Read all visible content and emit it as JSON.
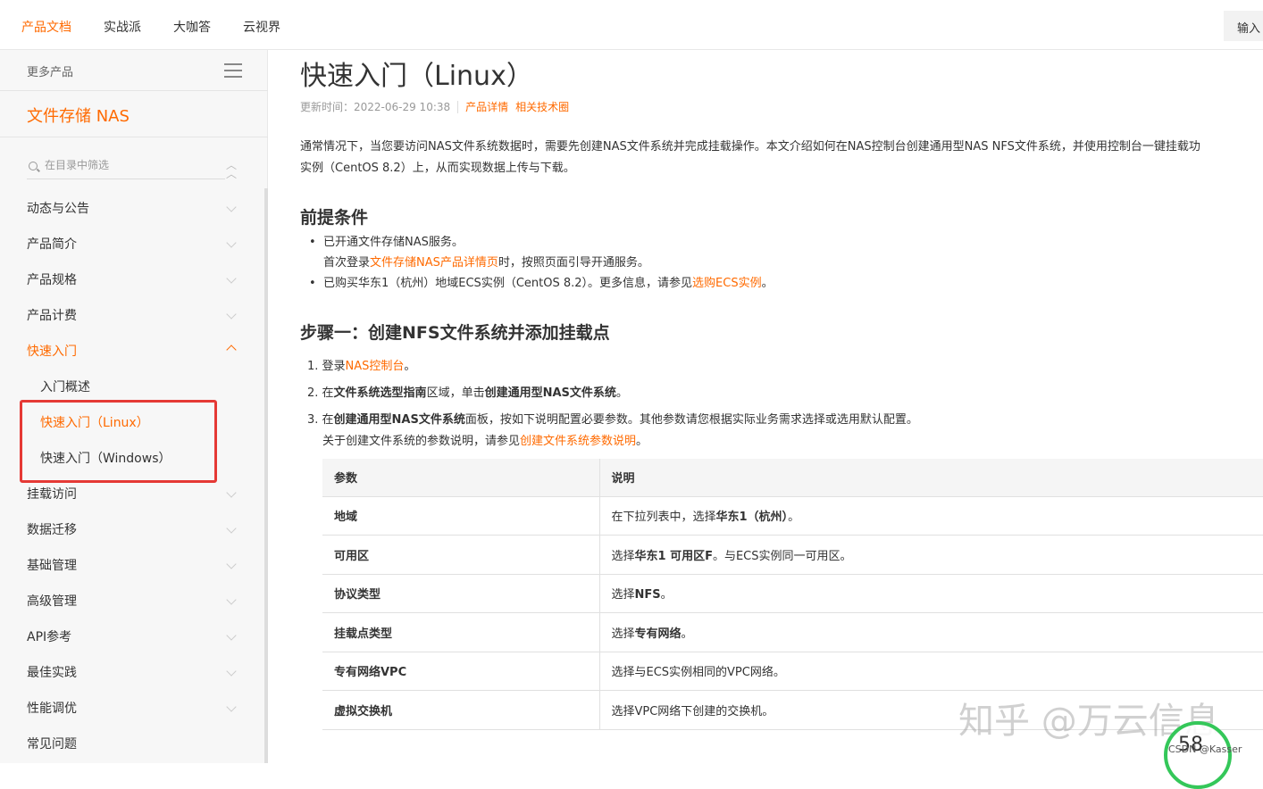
{
  "topnav": {
    "tabs": [
      "产品文档",
      "实战派",
      "大咖答",
      "云视界"
    ],
    "input_btn": "输入"
  },
  "sidebar": {
    "more_products": "更多产品",
    "product_title": "文件存储 NAS",
    "filter_placeholder": "在目录中筛选",
    "items": [
      "动态与公告",
      "产品简介",
      "产品规格",
      "产品计费",
      "快速入门",
      "挂载访问",
      "数据迁移",
      "基础管理",
      "高级管理",
      "API参考",
      "最佳实践",
      "性能调优",
      "常见问题"
    ],
    "sub_items": [
      "入门概述",
      "快速入门（Linux）",
      "快速入门（Windows）"
    ]
  },
  "main": {
    "title": "快速入门（Linux）",
    "meta": {
      "updated": "更新时间：2022-06-29 10:38",
      "link1": "产品详情",
      "link2": "相关技术圈"
    },
    "intro_line1": "通常情况下，当您要访问NAS文件系统数据时，需要先创建NAS文件系统并完成挂载操作。本文介绍如何在NAS控制台创建通用型NAS NFS文件系统，并使用控制台一键挂载功",
    "intro_line2": "实例（CentOS 8.2）上，从而实现数据上传与下载。",
    "prereq_heading": "前提条件",
    "prereq": {
      "b1": "已开通文件存储NAS服务。",
      "b1_sub_a": "首次登录",
      "b1_sub_link": "文件存储NAS产品详情页",
      "b1_sub_b": "时，按照页面引导开通服务。",
      "b2_a": "已购买华东1（杭州）地域ECS实例（CentOS 8.2）。更多信息，请参见",
      "b2_link": "选购ECS实例",
      "b2_b": "。"
    },
    "step1_heading": "步骤一：创建NFS文件系统并添加挂载点",
    "steps": {
      "s1_a": "1. 登录",
      "s1_link": "NAS控制台",
      "s1_b": "。",
      "s2_a": "2. 在",
      "s2_bold1": "文件系统选型指南",
      "s2_b": "区域，单击",
      "s2_bold2": "创建通用型NAS文件系统",
      "s2_c": "。",
      "s3_a": "3. 在",
      "s3_bold": "创建通用型NAS文件系统",
      "s3_b": "面板，按如下说明配置必要参数。其他参数请您根据实际业务需求选择或选用默认配置。",
      "s3_sub_a": "关于创建文件系统的参数说明，请参见",
      "s3_sub_link": "创建文件系统参数说明",
      "s3_sub_b": "。"
    },
    "table": {
      "headers": [
        "参数",
        "说明"
      ],
      "rows": [
        {
          "param": "地域",
          "desc_a": "在下拉列表中，选择",
          "desc_bold": "华东1（杭州）",
          "desc_b": "。"
        },
        {
          "param": "可用区",
          "desc_a": "选择",
          "desc_bold": "华东1 可用区F",
          "desc_b": "。与ECS实例同一可用区。"
        },
        {
          "param": "协议类型",
          "desc_a": "选择",
          "desc_bold": "NFS",
          "desc_b": "。"
        },
        {
          "param": "挂载点类型",
          "desc_a": "选择",
          "desc_bold": "专有网络",
          "desc_b": "。"
        },
        {
          "param": "专有网络VPC",
          "desc_a": "选择与ECS实例相同的VPC网络。",
          "desc_bold": "",
          "desc_b": ""
        },
        {
          "param": "虚拟交换机",
          "desc_a": "选择VPC网络下创建的交换机。",
          "desc_bold": "",
          "desc_b": ""
        }
      ]
    }
  },
  "overlay": {
    "watermark": "知乎 @万云信息",
    "badge": "58",
    "csdn": "CSDN @Kasser"
  },
  "colors": {
    "accent": "#ff6a00",
    "highlight": "#e53935"
  }
}
